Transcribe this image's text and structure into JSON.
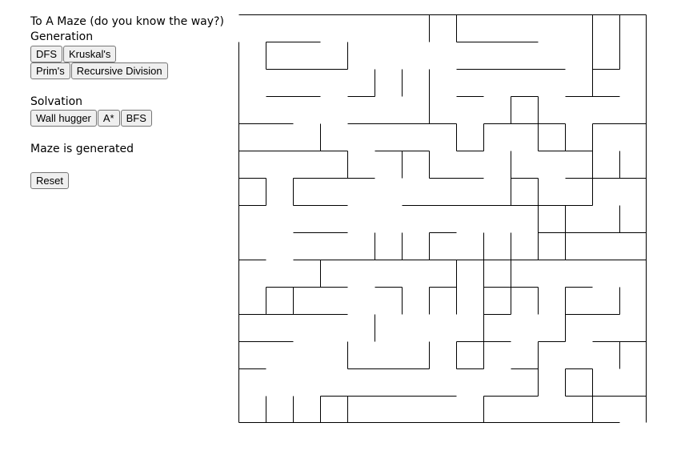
{
  "app": {
    "title": "To A Maze (do you know the way?)"
  },
  "generation": {
    "label": "Generation",
    "buttons": [
      "DFS",
      "Kruskal's",
      "Prim's",
      "Recursive Division"
    ]
  },
  "solvation": {
    "label": "Solvation",
    "buttons": [
      "Wall hugger",
      "A*",
      "BFS"
    ]
  },
  "status": {
    "text": "Maze is generated"
  },
  "controls": {
    "reset_label": "Reset"
  },
  "maze": {
    "rows": 15,
    "cols": 15,
    "wall_color": "#000000",
    "entrance": "top-left",
    "exit": "bottom-right"
  }
}
